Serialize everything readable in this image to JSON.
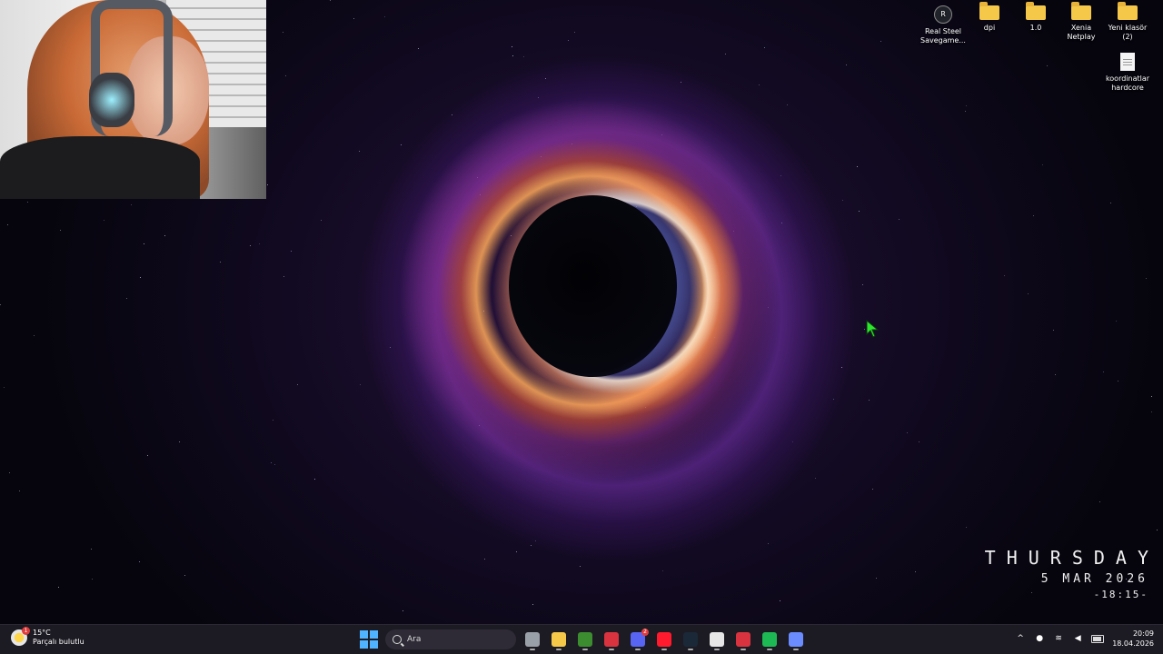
{
  "desktop_icons": [
    {
      "label": "Real Steel Savegame...",
      "icon": "app-icon"
    },
    {
      "label": "dpi",
      "icon": "folder-icon"
    },
    {
      "label": "1.0",
      "icon": "folder-icon"
    },
    {
      "label": "Xenia Netplay",
      "icon": "folder-icon"
    },
    {
      "label": "Yeni klasör (2)",
      "icon": "folder-icon"
    },
    {
      "label": "koordinatlar hardcore",
      "icon": "text-file-icon"
    }
  ],
  "widget": {
    "day": "THURSDAY",
    "date": "5 MAR 2026",
    "time": "-18:15-"
  },
  "taskbar": {
    "weather": {
      "temperature": "15°C",
      "condition": "Parçalı bulutlu",
      "badge": "1"
    },
    "search_label": "Ara",
    "apps": [
      {
        "name": "task-view",
        "color": "#9aa0a8"
      },
      {
        "name": "file-explorer",
        "color": "#f5c84a"
      },
      {
        "name": "minecraft",
        "color": "#3c8d2f"
      },
      {
        "name": "app-red-1",
        "color": "#d9333f"
      },
      {
        "name": "discord",
        "color": "#5865f2",
        "badge": "2"
      },
      {
        "name": "opera",
        "color": "#ff1b2d"
      },
      {
        "name": "steam",
        "color": "#1b2838"
      },
      {
        "name": "github",
        "color": "#e6e6e6"
      },
      {
        "name": "app-red-2",
        "color": "#d9333f"
      },
      {
        "name": "spotify",
        "color": "#1db954"
      },
      {
        "name": "app-settings",
        "color": "#6a8cff"
      }
    ],
    "clock_time": "20:09",
    "clock_date": "18.04.2026"
  }
}
